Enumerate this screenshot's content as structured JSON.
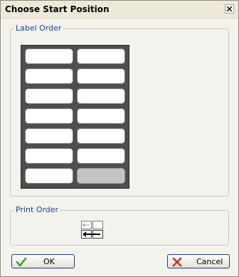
{
  "dialog": {
    "title": "Choose Start Position",
    "close_icon": "close-icon"
  },
  "label_order": {
    "legend": "Label Order",
    "columns": 2,
    "rows": 7,
    "empty_cells": [
      13
    ]
  },
  "print_order": {
    "legend": "Print Order",
    "icon": "print-order-arrows-icon"
  },
  "buttons": {
    "ok_label": "OK",
    "ok_icon": "checkmark-icon",
    "cancel_label": "Cancel",
    "cancel_icon": "x-icon"
  },
  "colors": {
    "legend": "#1a46a8",
    "ok_check": "#3fa51f",
    "cancel_x": "#d42b1e"
  }
}
